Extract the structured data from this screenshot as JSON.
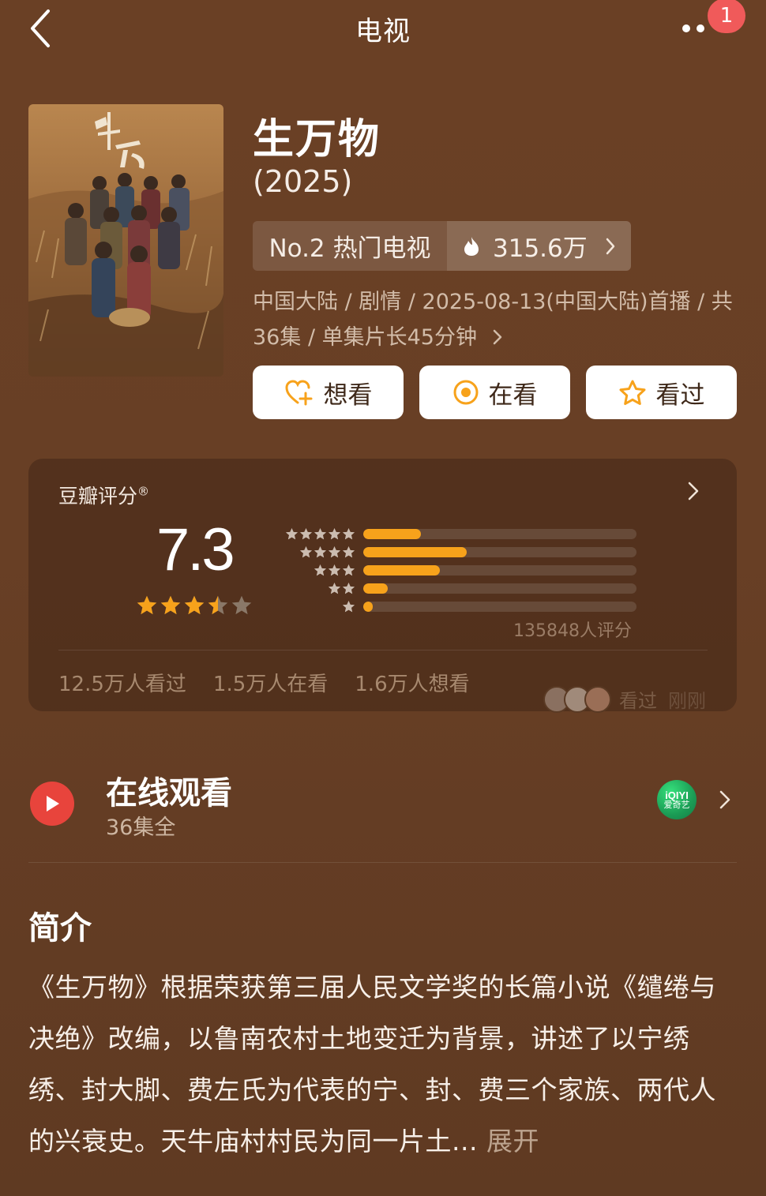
{
  "topbar": {
    "title": "电视",
    "notification_count": "1"
  },
  "show": {
    "title": "生万物",
    "year": "(2025)",
    "rank": "No.2 热门电视",
    "heat": "315.6万",
    "meta": "中国大陆 / 剧情 / 2025-08-13(中国大陆)首播 / 共36集 / 单集片长45分钟"
  },
  "actions": [
    {
      "label": "想看",
      "icon": "heart-plus-icon"
    },
    {
      "label": "在看",
      "icon": "target-icon"
    },
    {
      "label": "看过",
      "icon": "star-outline-icon"
    }
  ],
  "rating": {
    "label": "豆瓣评分",
    "label_mark": "®",
    "score": "7.3",
    "stars": 3.5,
    "distribution": [
      {
        "stars": 5,
        "fraction": 0.21
      },
      {
        "stars": 4,
        "fraction": 0.38
      },
      {
        "stars": 3,
        "fraction": 0.28
      },
      {
        "stars": 2,
        "fraction": 0.09
      },
      {
        "stars": 1,
        "fraction": 0.035
      }
    ],
    "count": "135848人评分",
    "watched": "12.5万人看过",
    "watching": "1.5万人在看",
    "want": "1.6万人想看",
    "recent_status": "看过",
    "recent_time": "刚刚"
  },
  "online": {
    "title": "在线观看",
    "subtitle": "36集全",
    "platform_logo": "iQIYI",
    "platform_name": "爱奇艺"
  },
  "intro": {
    "heading": "简介",
    "text": "《生万物》根据荣获第三届人民文学奖的长篇小说《缱绻与决绝》改编，以鲁南农村土地变迁为背景，讲述了以宁绣绣、封大脚、费左氏为代表的宁、封、费三个家族、两代人的兴衰史。天牛庙村村民为同一片土...",
    "expand": "展开"
  },
  "colors": {
    "background": "#6a4025",
    "accent_orange": "#f7a21b",
    "play_red": "#e8443c",
    "badge_red": "#f05a5a"
  }
}
